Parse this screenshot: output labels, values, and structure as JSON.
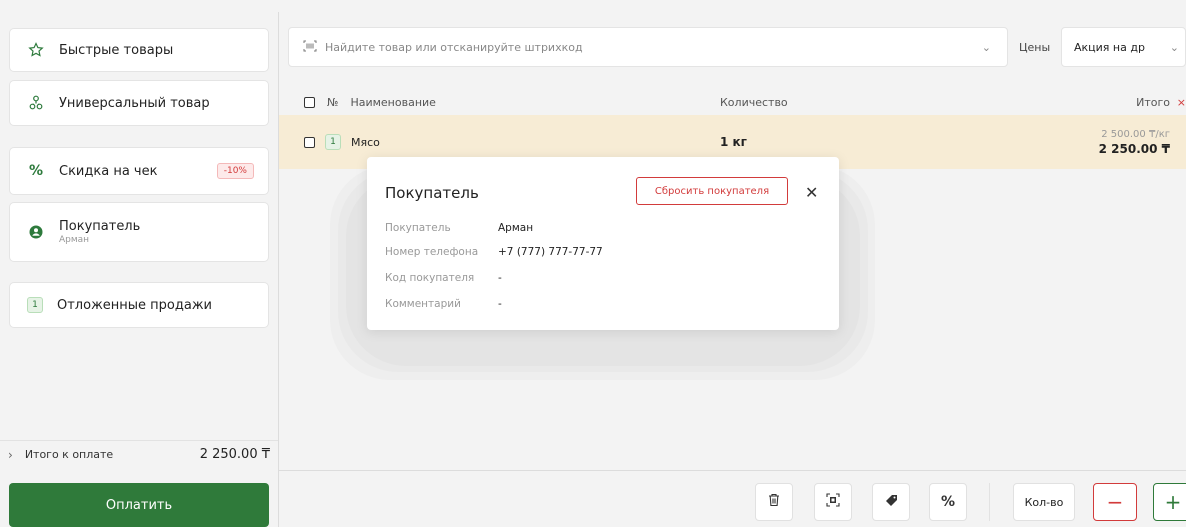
{
  "left_panel": {
    "quick_items": "Быстрые товары",
    "universal_item": "Универсальный товар",
    "discount": {
      "label": "Скидка на чек",
      "badge": "-10%"
    },
    "customer": {
      "label": "Покупатель",
      "name": "Арман"
    },
    "postponed": {
      "count": "1",
      "label": "Отложенные продажи"
    },
    "total": {
      "label": "Итого к оплате",
      "amount": "2 250.00 ₸"
    },
    "pay_button": "Оплатить"
  },
  "search": {
    "placeholder": "Найдите товар или отсканируйте штрихкод"
  },
  "prices": {
    "label": "Цены",
    "selected": "Акция на др"
  },
  "table": {
    "headers": {
      "number": "№",
      "name": "Наименование",
      "quantity": "Количество",
      "total": "Итого"
    },
    "rows": [
      {
        "index": "1",
        "name": "Мясо",
        "quantity": "1 кг",
        "unit_price": "2 500.00 ₸/кг",
        "sum": "2 250.00 ₸"
      }
    ]
  },
  "toolbar": {
    "quantity_label": "Кол-во",
    "minus": "−",
    "plus": "+"
  },
  "modal": {
    "title": "Покупатель",
    "reset_button": "Сбросить покупателя",
    "fields": [
      {
        "key": "Покупатель",
        "value": "Арман"
      },
      {
        "key": "Номер телефона",
        "value": "+7 (777) 777-77-77"
      },
      {
        "key": "Код покупателя",
        "value": "-"
      },
      {
        "key": "Комментарий",
        "value": "-"
      }
    ]
  },
  "colors": {
    "accent_green": "#2f7a3a",
    "danger_red": "#d23b3b",
    "row_highlight": "#f7ecd5"
  }
}
